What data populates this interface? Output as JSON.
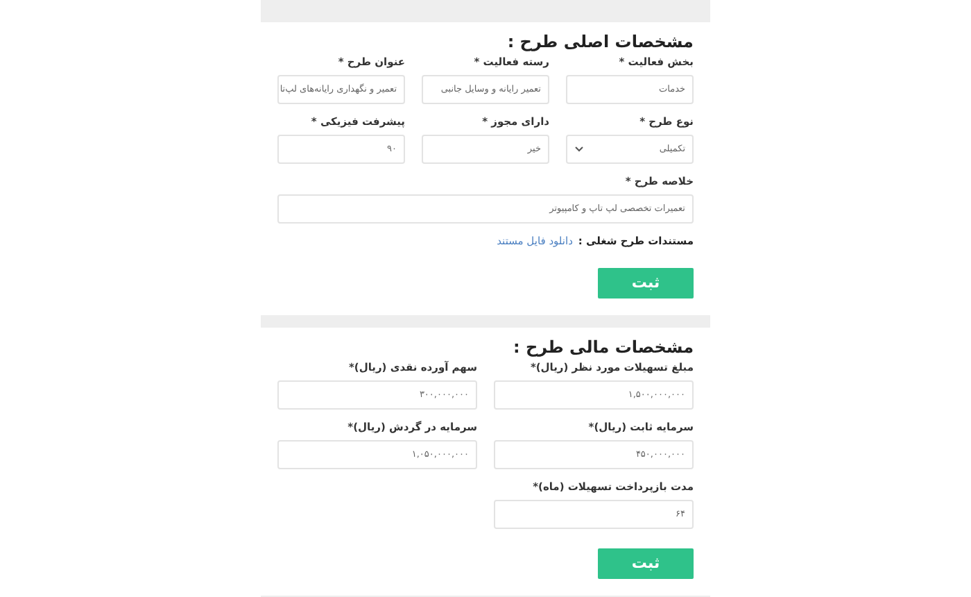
{
  "sections": [
    {
      "title": "مشخصات اصلی طرح :",
      "rows": [
        [
          {
            "kind": "text",
            "label": "بخش فعالیت *",
            "value": "خدمات"
          },
          {
            "kind": "text",
            "label": "رسته فعالیت *",
            "value": "تعمیر رایانه و وسایل جانبی"
          },
          {
            "kind": "text",
            "label": "عنوان طرح *",
            "value": "تعمیر و نگهداری رایانه‌های لپ‌تا"
          }
        ],
        [
          {
            "kind": "select",
            "label": "نوع طرح *",
            "value": "تکمیلی"
          },
          {
            "kind": "text",
            "label": "دارای مجوز *",
            "value": "خیر"
          },
          {
            "kind": "text",
            "label": "پیشرفت فیزیکی *",
            "value": "۹۰"
          }
        ],
        [
          {
            "kind": "textarea",
            "label": "خلاصه طرح *",
            "value": "تعمیرات تخصصی لپ تاپ و کامپیوتر"
          }
        ]
      ],
      "documents": {
        "label": "مستندات طرح شغلی :",
        "link": "دانلود فایل مستند"
      },
      "button": "ثبت"
    },
    {
      "title": "مشخصات مالی طرح :",
      "rows": [
        [
          {
            "kind": "text",
            "label": "مبلغ تسهیلات مورد نظر (ریال)*",
            "value": "۱,۵۰۰,۰۰۰,۰۰۰"
          },
          {
            "kind": "text",
            "label": "سهم آورده نقدی (ریال)*",
            "value": "۳۰۰,۰۰۰,۰۰۰"
          }
        ],
        [
          {
            "kind": "text",
            "label": "سرمایه ثابت (ریال)*",
            "value": "۴۵۰,۰۰۰,۰۰۰"
          },
          {
            "kind": "text",
            "label": "سرمایه در گردش (ریال)*",
            "value": "۱,۰۵۰,۰۰۰,۰۰۰"
          }
        ],
        [
          {
            "kind": "text",
            "label": "مدت بازپرداخت تسهیلات (ماه)*",
            "value": "۶۴"
          }
        ]
      ],
      "button": "ثبت"
    }
  ]
}
